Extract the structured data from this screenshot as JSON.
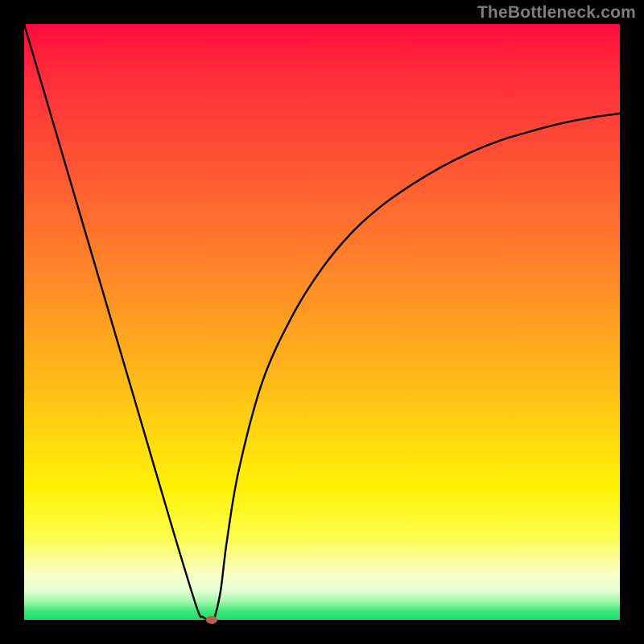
{
  "watermark": "TheBottleneck.com",
  "chart_data": {
    "type": "line",
    "title": "",
    "xlabel": "",
    "ylabel": "",
    "xlim": [
      0,
      1
    ],
    "ylim": [
      0,
      1
    ],
    "background": "rainbow-vertical",
    "background_colors": {
      "top": "#ff0b3c",
      "mid": "#ffd40f",
      "bottom": "#16df6e"
    },
    "series": [
      {
        "name": "bottleneck-curve",
        "x": [
          0.0,
          0.05,
          0.1,
          0.15,
          0.2,
          0.25,
          0.29,
          0.3,
          0.31,
          0.315,
          0.32,
          0.33,
          0.34,
          0.36,
          0.4,
          0.45,
          0.5,
          0.55,
          0.6,
          0.65,
          0.7,
          0.75,
          0.8,
          0.85,
          0.9,
          0.95,
          1.0
        ],
        "y": [
          1.0,
          0.83,
          0.66,
          0.49,
          0.32,
          0.15,
          0.02,
          0.005,
          0.0,
          0.0,
          0.005,
          0.05,
          0.13,
          0.25,
          0.4,
          0.51,
          0.59,
          0.65,
          0.695,
          0.73,
          0.76,
          0.785,
          0.805,
          0.82,
          0.833,
          0.843,
          0.85
        ]
      }
    ],
    "marker": {
      "name": "sweet-spot",
      "x": 0.315,
      "y": 0.0,
      "color": "#bb5e4e"
    }
  }
}
